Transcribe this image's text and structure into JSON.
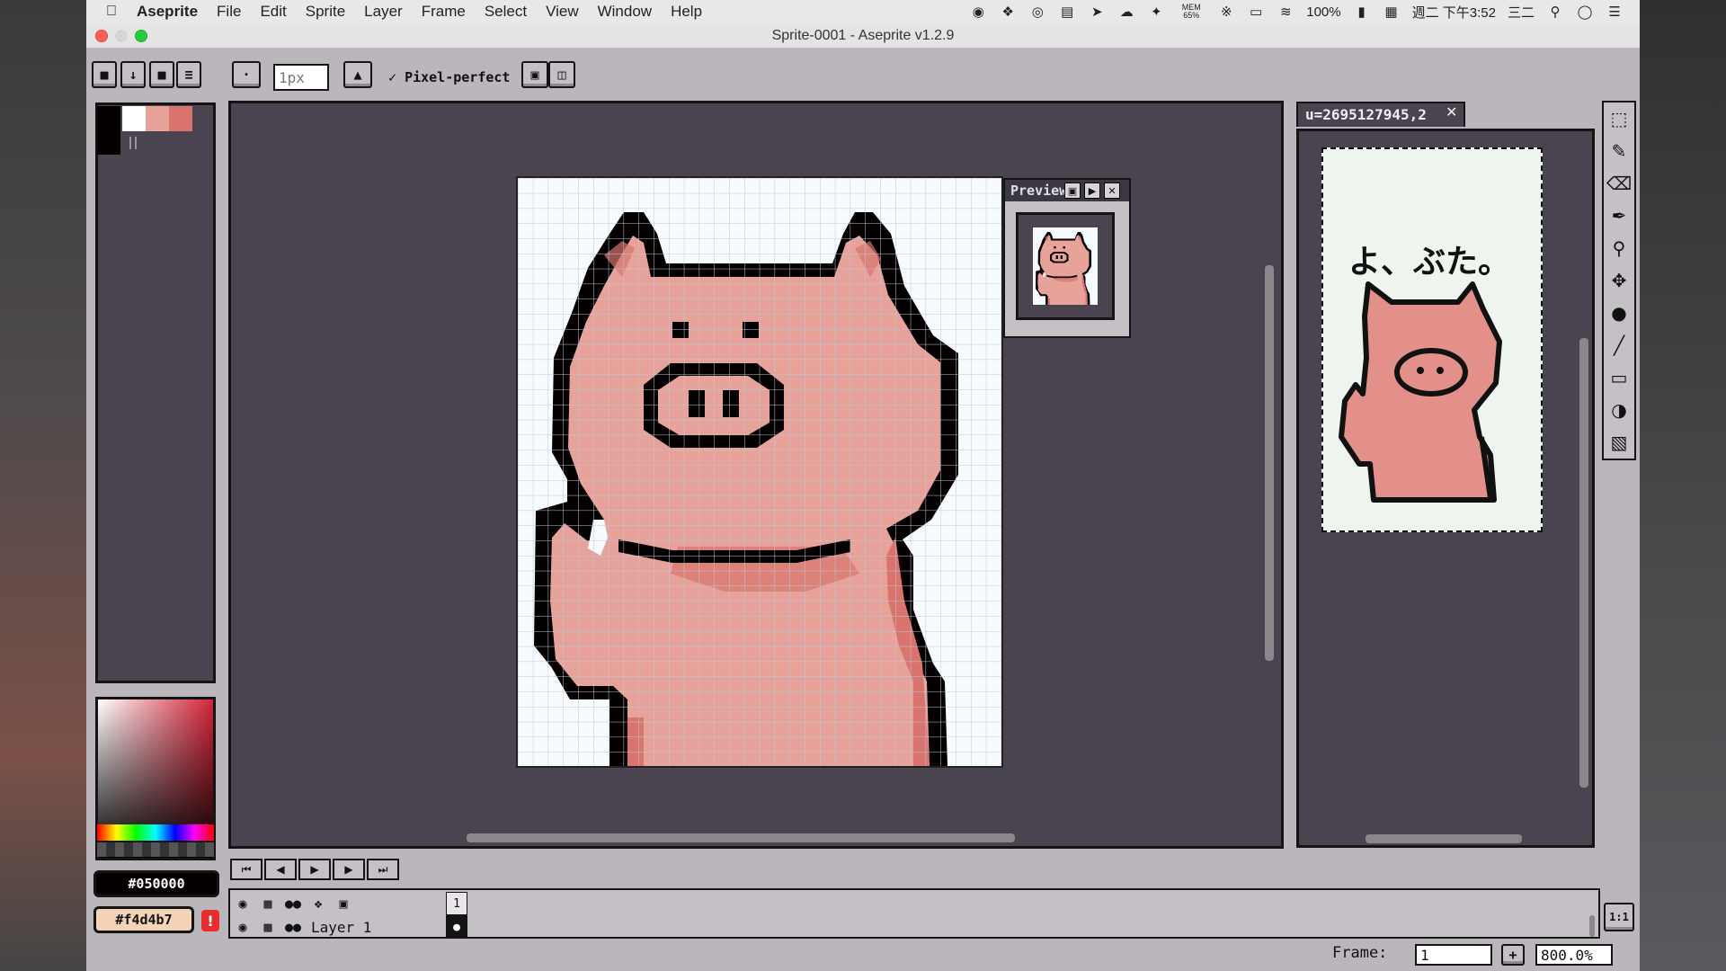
{
  "menubar": {
    "app_name": "Aseprite",
    "items": [
      "File",
      "Edit",
      "Sprite",
      "Layer",
      "Frame",
      "Select",
      "View",
      "Window",
      "Help"
    ],
    "tray": {
      "memory_label": "MEM",
      "memory_value": "65%",
      "battery": "100%",
      "clock": "週二 下午3:52",
      "input_method": "三二"
    }
  },
  "window": {
    "title": "Sprite-0001 - Aseprite v1.2.9"
  },
  "toolbar": {
    "brush_size_placeholder": "1px",
    "pixel_perfect_label": "Pixel-perfect",
    "pixel_perfect_checked": true
  },
  "palette": {
    "colors": [
      "#ffffff",
      "#e7a299",
      "#d9736e"
    ],
    "foreground_hex": "#050000",
    "background_hex": "#f4d4b7"
  },
  "preview_window": {
    "title": "Preview"
  },
  "reference_tab": {
    "label": "u=2695127945,2"
  },
  "reference_image": {
    "caption": "よ、ぶた。"
  },
  "timeline": {
    "layers": [
      {
        "name": "Layer 1"
      }
    ],
    "frames": [
      "1"
    ]
  },
  "status": {
    "frame_label": "Frame:",
    "frame_value": "1",
    "zoom_value": "800.0%"
  },
  "colors": {
    "outline": "#050000",
    "skin": "#e7a299",
    "shadow": "#d9736e",
    "canvas_bg": "#4a4450"
  }
}
